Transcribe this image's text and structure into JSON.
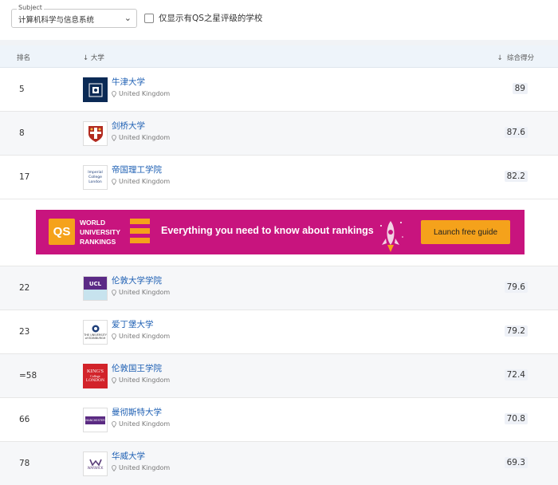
{
  "filters": {
    "subject_legend": "Subject",
    "subject_value": "计算机科学与信息系统",
    "qs_only_label": "仅显示有QS之星评级的学校"
  },
  "table_header": {
    "rank": "排名",
    "university": "大学",
    "score": "综合得分",
    "sort_icon": "arrow-down-icon"
  },
  "rows": [
    {
      "rank": "5",
      "name": "牛津大学",
      "country": "United Kingdom",
      "score": "89"
    },
    {
      "rank": "8",
      "name": "剑桥大学",
      "country": "United Kingdom",
      "score": "87.6"
    },
    {
      "rank": "17",
      "name": "帝国理工学院",
      "country": "United Kingdom",
      "score": "82.2"
    },
    {
      "rank": "22",
      "name": "伦敦大学学院",
      "country": "United Kingdom",
      "score": "79.6"
    },
    {
      "rank": "23",
      "name": "爱丁堡大学",
      "country": "United Kingdom",
      "score": "79.2"
    },
    {
      "rank": "=58",
      "name": "伦敦国王学院",
      "country": "United Kingdom",
      "score": "72.4"
    },
    {
      "rank": "66",
      "name": "曼彻斯特大学",
      "country": "United Kingdom",
      "score": "70.8"
    },
    {
      "rank": "78",
      "name": "华威大学",
      "country": "United Kingdom",
      "score": "69.3"
    }
  ],
  "logos": {
    "imperial": "Imperial College London",
    "ucl": "UCL",
    "edinburgh": "THE UNIVERSITY of EDINBURGH",
    "kings_1": "KING'S",
    "kings_2": "College",
    "kings_3": "LONDON",
    "manchester": "MANCHESTER",
    "warwick": "WARWICK"
  },
  "banner": {
    "logo": "QS",
    "wur_line1": "WORLD",
    "wur_line2": "UNIVERSITY",
    "wur_line3": "RANKINGS",
    "tagline": "Everything you need to know about rankings",
    "cta": "Launch free guide",
    "bg_color": "#c8147e",
    "accent_color": "#f5a21b"
  }
}
